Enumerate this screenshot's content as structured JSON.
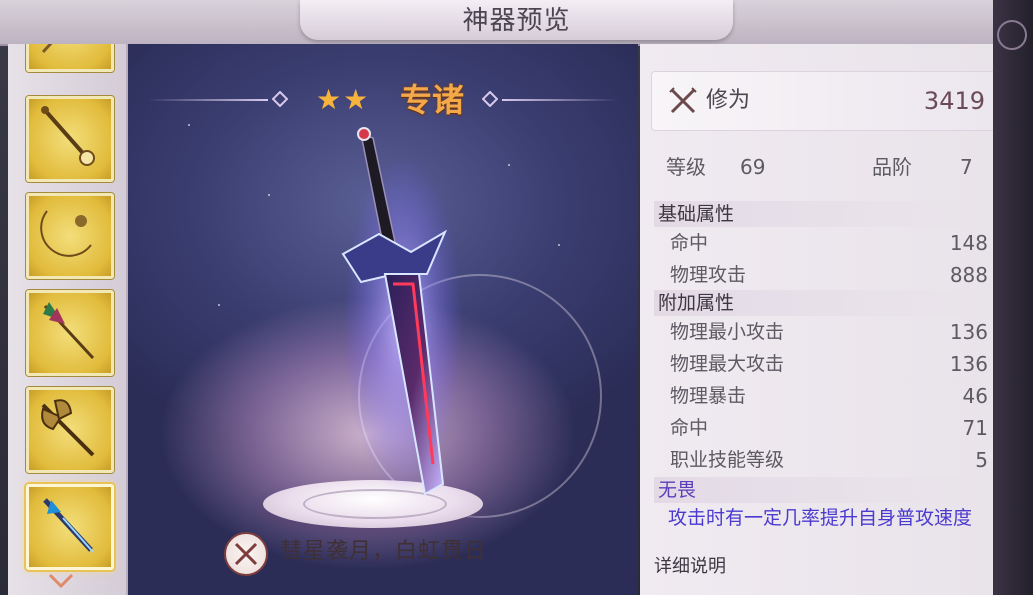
{
  "window": {
    "title": "神器预览"
  },
  "rail": {
    "items": [
      {
        "name": "staff-partial",
        "selected": false
      },
      {
        "name": "golden-scepter",
        "selected": false
      },
      {
        "name": "crescent-blade",
        "selected": false
      },
      {
        "name": "ornate-spear",
        "selected": false
      },
      {
        "name": "battle-axe",
        "selected": false
      },
      {
        "name": "blue-sword",
        "selected": true
      }
    ]
  },
  "showcase": {
    "stars": "★★",
    "item_name": "专诸",
    "skill_text": "彗星袭月，白虹贯日"
  },
  "stats": {
    "power_label": "修为",
    "power_value": "3419",
    "level_label": "等级",
    "level_value": "69",
    "grade_label": "品阶",
    "grade_value": "7",
    "base_section": "基础属性",
    "base_attrs": [
      {
        "label": "命中",
        "value": "148"
      },
      {
        "label": "物理攻击",
        "value": "888"
      }
    ],
    "extra_section": "附加属性",
    "extra_attrs": [
      {
        "label": "物理最小攻击",
        "value": "136"
      },
      {
        "label": "物理最大攻击",
        "value": "136"
      },
      {
        "label": "物理暴击",
        "value": "46"
      },
      {
        "label": "命中",
        "value": "71"
      },
      {
        "label": "职业技能等级",
        "value": "5"
      }
    ],
    "special_name": "无畏",
    "special_desc": "攻击时有一定几率提升自身普攻速度",
    "detail_header": "详细说明"
  },
  "colors": {
    "title_text": "#4b4650",
    "name_orange": "#f3a94a",
    "star_gold": "#f6b43c",
    "special_purple": "#4a3ad0"
  }
}
